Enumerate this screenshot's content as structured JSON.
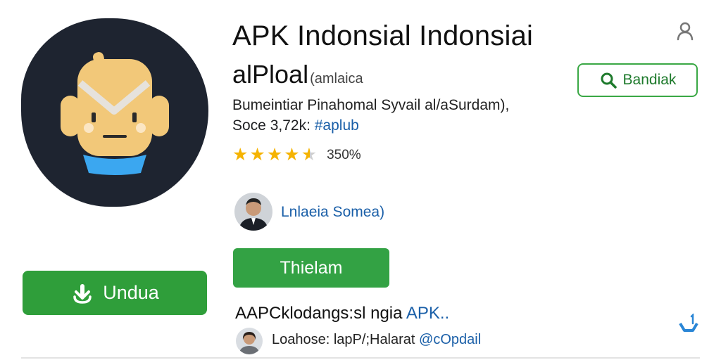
{
  "app": {
    "title": "APK Indonsial Indonsiai",
    "subtitle_main": "alPloal",
    "subtitle_small": "(amlaica",
    "description": "Bumeintiar Pinahomal Syvail al/aSurdam),",
    "meta_text": "Soce 3,72k: ",
    "meta_tag": "#aplub",
    "rating_value": "350%",
    "rating_stars": 4.5
  },
  "developer": {
    "name": "Lnlaeia Somea)"
  },
  "buttons": {
    "download_label": "Undua",
    "install_label": "Thielam",
    "search_label": "Bandiak"
  },
  "section": {
    "title_main": "AAPCklodangs:sl ngia ",
    "title_accent": "APK.."
  },
  "comment": {
    "text": "Loahose: lapP/;Halarat ",
    "handle": "@cOpdail"
  },
  "colors": {
    "accent_green": "#2f9e3a",
    "link_blue": "#1a5fa8",
    "icon_bg": "#1e2430",
    "star": "#f5b301"
  },
  "icons": [
    "android-robot-icon",
    "download-icon",
    "search-icon",
    "user-icon",
    "share-icon",
    "star-icon"
  ]
}
